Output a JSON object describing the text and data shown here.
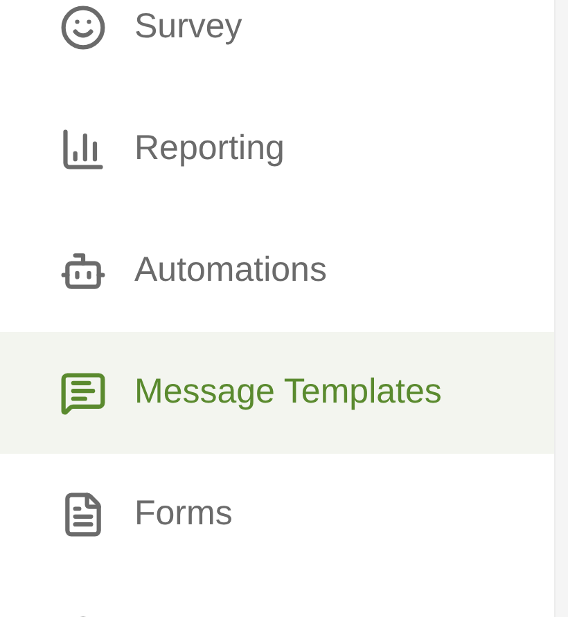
{
  "nav_items": [
    {
      "label": "Survey",
      "selected": false
    },
    {
      "label": "Reporting",
      "selected": false
    },
    {
      "label": "Automations",
      "selected": false
    },
    {
      "label": "Message Templates",
      "selected": true
    },
    {
      "label": "Forms",
      "selected": false
    }
  ]
}
